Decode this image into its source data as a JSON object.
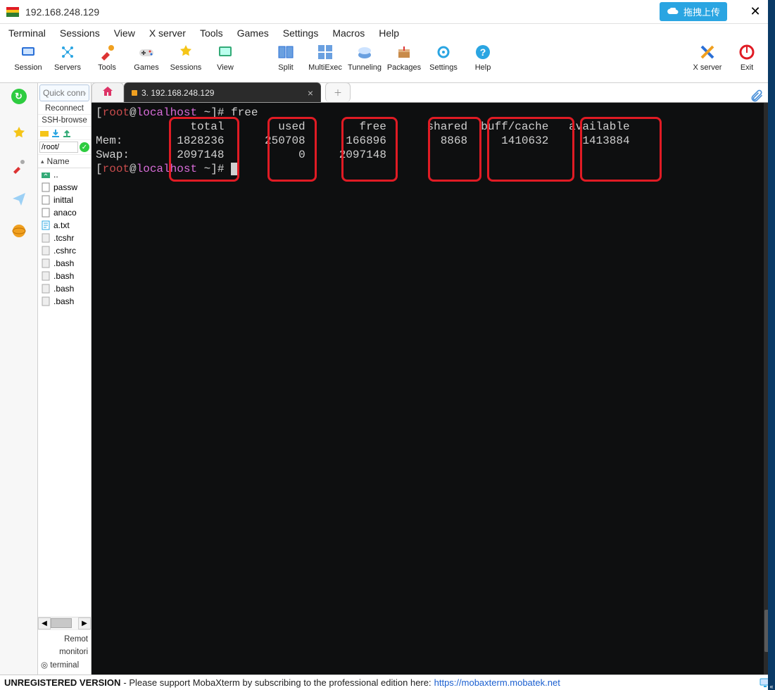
{
  "window": {
    "title": "192.168.248.129"
  },
  "upload_button": "拖拽上传",
  "menu": [
    "Terminal",
    "Sessions",
    "View",
    "X server",
    "Tools",
    "Games",
    "Settings",
    "Macros",
    "Help"
  ],
  "toolbar": [
    {
      "icon": "session",
      "label": "Session"
    },
    {
      "icon": "servers",
      "label": "Servers"
    },
    {
      "icon": "tools",
      "label": "Tools"
    },
    {
      "icon": "games",
      "label": "Games"
    },
    {
      "icon": "sessions",
      "label": "Sessions"
    },
    {
      "icon": "view",
      "label": "View"
    },
    {
      "icon": "split",
      "label": "Split"
    },
    {
      "icon": "multiexec",
      "label": "MultiExec"
    },
    {
      "icon": "tunneling",
      "label": "Tunneling"
    },
    {
      "icon": "packages",
      "label": "Packages"
    },
    {
      "icon": "settings",
      "label": "Settings"
    },
    {
      "icon": "help",
      "label": "Help"
    }
  ],
  "toolbar_right": [
    {
      "icon": "xserver",
      "label": "X server"
    },
    {
      "icon": "exit",
      "label": "Exit"
    }
  ],
  "sidebar": {
    "quick_placeholder": "Quick connec",
    "reconnect": "Reconnect",
    "ssh_browser": "SSH-browse",
    "path": "/root/",
    "name_header": "Name",
    "files": [
      {
        "name": "..",
        "type": "up"
      },
      {
        "name": "passw",
        "type": "file"
      },
      {
        "name": "inittal",
        "type": "file"
      },
      {
        "name": "anaco",
        "type": "file"
      },
      {
        "name": "a.txt",
        "type": "txt"
      },
      {
        "name": ".tcshr",
        "type": "hidden"
      },
      {
        "name": ".cshrc",
        "type": "hidden"
      },
      {
        "name": ".bash",
        "type": "hidden"
      },
      {
        "name": ".bash",
        "type": "hidden"
      },
      {
        "name": ".bash",
        "type": "hidden"
      },
      {
        "name": ".bash",
        "type": "hidden"
      }
    ],
    "remote_label": "Remot",
    "monitoring_label": "monitori",
    "terminal_label": "terminal"
  },
  "tabs": {
    "active_label": "3. 192.168.248.129"
  },
  "terminal": {
    "prompt_user": "root",
    "prompt_at": "@",
    "prompt_host": "localhost",
    "prompt_tail": " ~]# ",
    "command": "free",
    "headers": [
      "total",
      "used",
      "free",
      "shared",
      "buff/cache",
      "available"
    ],
    "rows": [
      {
        "label": "Mem:",
        "total": "1828236",
        "used": "250708",
        "free": "166896",
        "shared": "8868",
        "buff": "1410632",
        "avail": "1413884"
      },
      {
        "label": "Swap:",
        "total": "2097148",
        "used": "0",
        "free": "2097148",
        "shared": "",
        "buff": "",
        "avail": ""
      }
    ]
  },
  "status": {
    "unreg": "UNREGISTERED VERSION",
    "msg": " -  Please support MobaXterm by subscribing to the professional edition here:  ",
    "link": "https://mobaxterm.mobatek.net"
  }
}
